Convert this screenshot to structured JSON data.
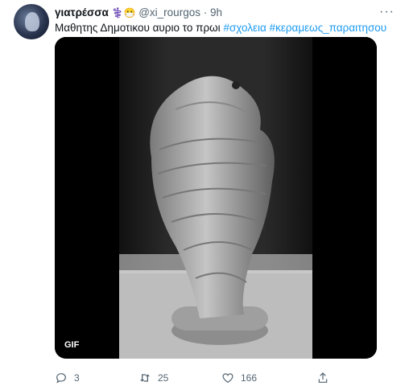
{
  "tweet": {
    "name": "γιατρέσσα",
    "name_emojis": "⚕️😷",
    "handle": "@xi_rourgos",
    "separator": "·",
    "time": "9h",
    "text_plain": "Μαθητης Δημοτικου αυριο το πρωι",
    "hashtags": [
      "#σχολεια",
      "#κεραμεως_παραιτησου"
    ],
    "media": {
      "badge": "GIF"
    },
    "actions": {
      "replies": "3",
      "retweets": "25",
      "likes": "166"
    }
  },
  "colors": {
    "link": "#1d9bf0",
    "secondary_text": "#536471"
  }
}
